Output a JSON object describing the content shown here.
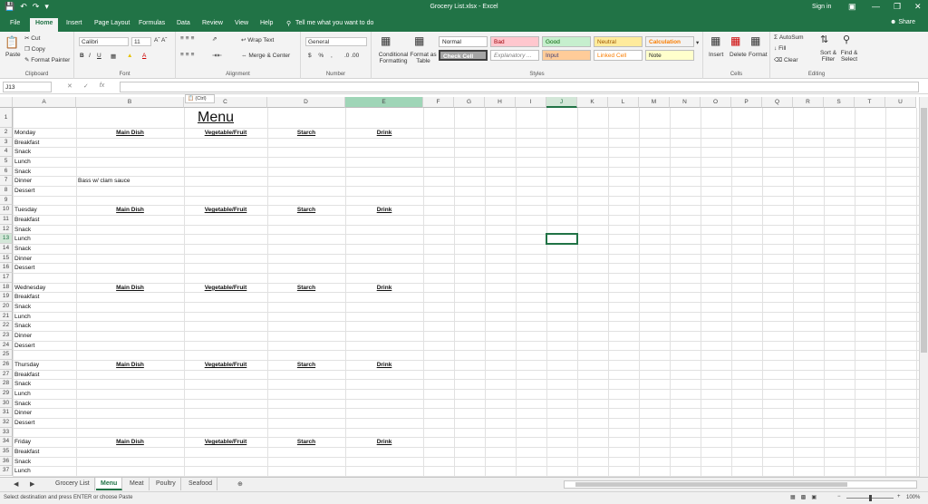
{
  "window": {
    "title": "Grocery List.xlsx - Excel",
    "sign_in": "Sign in",
    "share": "Share"
  },
  "tabs": [
    "File",
    "Home",
    "Insert",
    "Page Layout",
    "Formulas",
    "Data",
    "Review",
    "View",
    "Help"
  ],
  "tell_me": "Tell me what you want to do",
  "clipboard": {
    "paste": "Paste",
    "cut": "Cut",
    "copy": "Copy",
    "format_painter": "Format Painter",
    "label": "Clipboard"
  },
  "font": {
    "name": "Calibri",
    "size": "11",
    "label": "Font"
  },
  "alignment": {
    "wrap_text": "Wrap Text",
    "merge_center": "Merge & Center",
    "label": "Alignment"
  },
  "number": {
    "format": "General",
    "label": "Number"
  },
  "styles": {
    "conditional_formatting": "Conditional Formatting",
    "format_as_table": "Format as Table",
    "cells": [
      "Normal",
      "Bad",
      "Good",
      "Neutral",
      "Calculation",
      "Check Cell",
      "Explanatory ...",
      "Input",
      "Linked Cell",
      "Note"
    ],
    "label": "Styles"
  },
  "cells_group": {
    "insert": "Insert",
    "delete": "Delete",
    "format": "Format",
    "label": "Cells"
  },
  "editing": {
    "autosum": "AutoSum",
    "fill": "Fill",
    "clear": "Clear",
    "sort_filter": "Sort & Filter",
    "find_select": "Find & Select",
    "label": "Editing"
  },
  "formula_bar": {
    "name_box": "J13",
    "fx": "fx",
    "content": ""
  },
  "columns": [
    "A",
    "B",
    "C",
    "D",
    "E",
    "F",
    "G",
    "H",
    "I",
    "J",
    "K",
    "L",
    "M",
    "N",
    "O",
    "P",
    "Q",
    "R",
    "S",
    "T",
    "U"
  ],
  "sheet": {
    "title": "Menu",
    "section_headers": [
      "Main Dish",
      "Vegetable/Fruit",
      "Starch",
      "Drink"
    ],
    "rows": [
      {
        "row": "1",
        "a": "",
        "b": ""
      },
      {
        "row": "2",
        "a": "Monday",
        "b": "",
        "header": true
      },
      {
        "row": "3",
        "a": "Breakfast",
        "b": ""
      },
      {
        "row": "4",
        "a": "Snack",
        "b": ""
      },
      {
        "row": "5",
        "a": "Lunch",
        "b": ""
      },
      {
        "row": "6",
        "a": "Snack",
        "b": ""
      },
      {
        "row": "7",
        "a": "Dinner",
        "b": "Bass w/ clam sauce"
      },
      {
        "row": "8",
        "a": "Dessert",
        "b": ""
      },
      {
        "row": "9",
        "a": "",
        "b": ""
      },
      {
        "row": "10",
        "a": "Tuesday",
        "b": "",
        "header": true
      },
      {
        "row": "11",
        "a": "Breakfast",
        "b": ""
      },
      {
        "row": "12",
        "a": "Snack",
        "b": ""
      },
      {
        "row": "13",
        "a": "Lunch",
        "b": ""
      },
      {
        "row": "14",
        "a": "Snack",
        "b": ""
      },
      {
        "row": "15",
        "a": "Dinner",
        "b": ""
      },
      {
        "row": "16",
        "a": "Dessert",
        "b": ""
      },
      {
        "row": "17",
        "a": "",
        "b": ""
      },
      {
        "row": "18",
        "a": "Wednesday",
        "b": "",
        "header": true
      },
      {
        "row": "19",
        "a": "Breakfast",
        "b": ""
      },
      {
        "row": "20",
        "a": "Snack",
        "b": ""
      },
      {
        "row": "21",
        "a": "Lunch",
        "b": ""
      },
      {
        "row": "22",
        "a": "Snack",
        "b": ""
      },
      {
        "row": "23",
        "a": "Dinner",
        "b": ""
      },
      {
        "row": "24",
        "a": "Dessert",
        "b": ""
      },
      {
        "row": "25",
        "a": "",
        "b": ""
      },
      {
        "row": "26",
        "a": "Thursday",
        "b": "",
        "header": true
      },
      {
        "row": "27",
        "a": "Breakfast",
        "b": ""
      },
      {
        "row": "28",
        "a": "Snack",
        "b": ""
      },
      {
        "row": "29",
        "a": "Lunch",
        "b": ""
      },
      {
        "row": "30",
        "a": "Snack",
        "b": ""
      },
      {
        "row": "31",
        "a": "Dinner",
        "b": ""
      },
      {
        "row": "32",
        "a": "Dessert",
        "b": ""
      },
      {
        "row": "33",
        "a": "",
        "b": ""
      },
      {
        "row": "34",
        "a": "Friday",
        "b": "",
        "header": true
      },
      {
        "row": "35",
        "a": "Breakfast",
        "b": ""
      },
      {
        "row": "36",
        "a": "Snack",
        "b": ""
      },
      {
        "row": "37",
        "a": "Lunch",
        "b": ""
      }
    ],
    "paste_options": "(Ctrl)"
  },
  "sheet_tabs": [
    "Grocery List",
    "Menu",
    "Meat",
    "Poultry",
    "Seafood"
  ],
  "active_sheet": "Menu",
  "status": {
    "message": "Select destination and press ENTER or choose Paste",
    "zoom": "100%"
  },
  "colors": {
    "accent": "#217346",
    "selection_header": "#d3e7d8"
  }
}
